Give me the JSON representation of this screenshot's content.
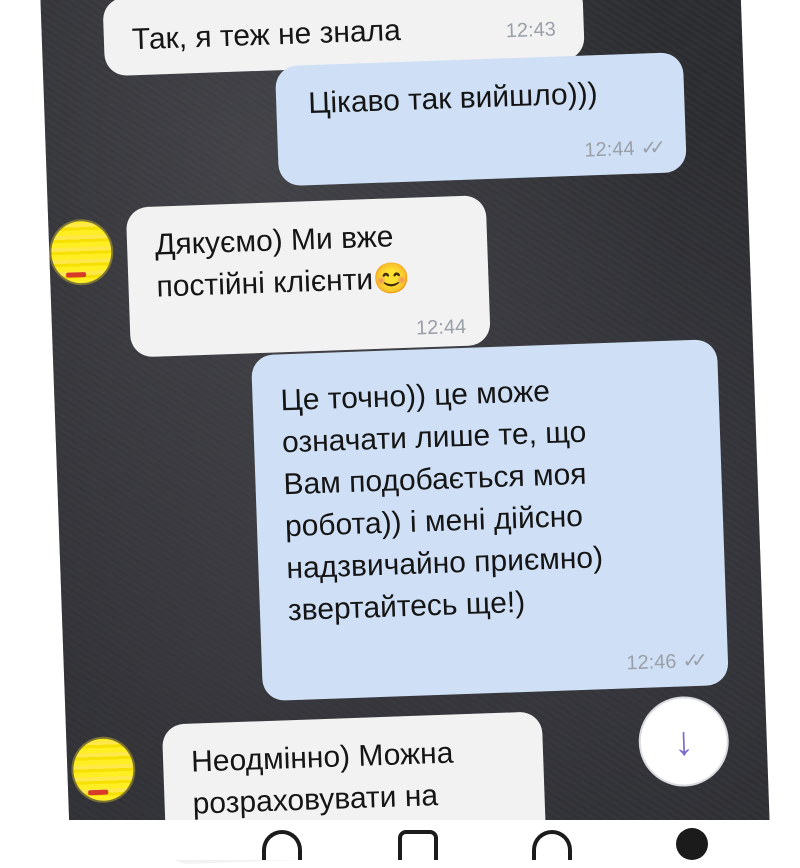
{
  "messages": [
    {
      "direction": "incoming",
      "text": "Так, я теж не знала",
      "time": "12:43"
    },
    {
      "direction": "outgoing",
      "text": "Цікаво так вийшло)))",
      "time": "12:44",
      "status": "read"
    },
    {
      "direction": "incoming",
      "line1": "Дякуємо) Ми вже",
      "line2": "постійні клієнти",
      "emoji": "😊",
      "time": "12:44"
    },
    {
      "direction": "outgoing",
      "lines": [
        "Це точно)) це може",
        "означати лише те, що",
        "Вам подобається моя",
        "робота)) і мені дійсно",
        "надзвичайно приємно)",
        "звертайтесь ще!)"
      ],
      "time": "12:46",
      "status": "read"
    },
    {
      "direction": "incoming",
      "lines": [
        "Неодмінно) Можна",
        "розраховувати на"
      ]
    }
  ],
  "icons": {
    "read_ticks": "✓✓",
    "scroll_down": "↓"
  },
  "colors": {
    "incoming_bubble": "#f2f2f2",
    "outgoing_bubble": "#cfe0f6",
    "accent": "#7e6bd0",
    "avatar": "#ffee22"
  }
}
